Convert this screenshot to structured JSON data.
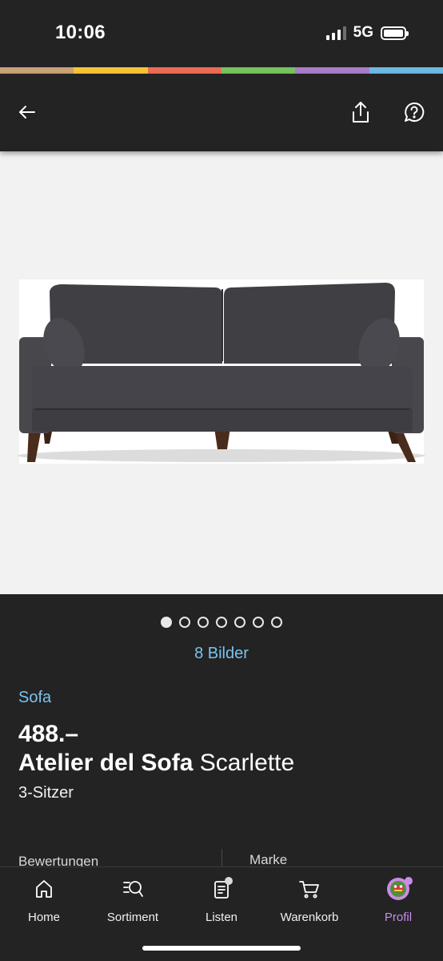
{
  "status_bar": {
    "time": "10:06",
    "network": "5G"
  },
  "brand_stripe_colors": [
    "#c9a276",
    "#f6c435",
    "#ee6c55",
    "#78c35c",
    "#a97dc9",
    "#6cb9e4"
  ],
  "header": {
    "back_icon": "arrow-left-icon",
    "share_icon": "share-icon",
    "help_icon": "help-bubble-icon"
  },
  "gallery": {
    "total_dots": 7,
    "active_index": 0,
    "images_label": "8 Bilder"
  },
  "product": {
    "category": "Sofa",
    "price": "488.–",
    "brand": "Atelier del Sofa",
    "name": "Scarlette",
    "variant": "3-Sitzer"
  },
  "meta": {
    "ratings_label": "Bewertungen",
    "brand_label": "Marke"
  },
  "tab_bar": {
    "items": [
      {
        "label": "Home",
        "icon": "home-icon"
      },
      {
        "label": "Sortiment",
        "icon": "search-list-icon"
      },
      {
        "label": "Listen",
        "icon": "list-icon"
      },
      {
        "label": "Warenkorb",
        "icon": "cart-icon"
      },
      {
        "label": "Profil",
        "icon": "avatar-icon"
      }
    ],
    "active_label": "Profil"
  },
  "colors": {
    "background": "#232323",
    "link_blue": "#7ac3ee",
    "active_purple": "#c98be8"
  }
}
